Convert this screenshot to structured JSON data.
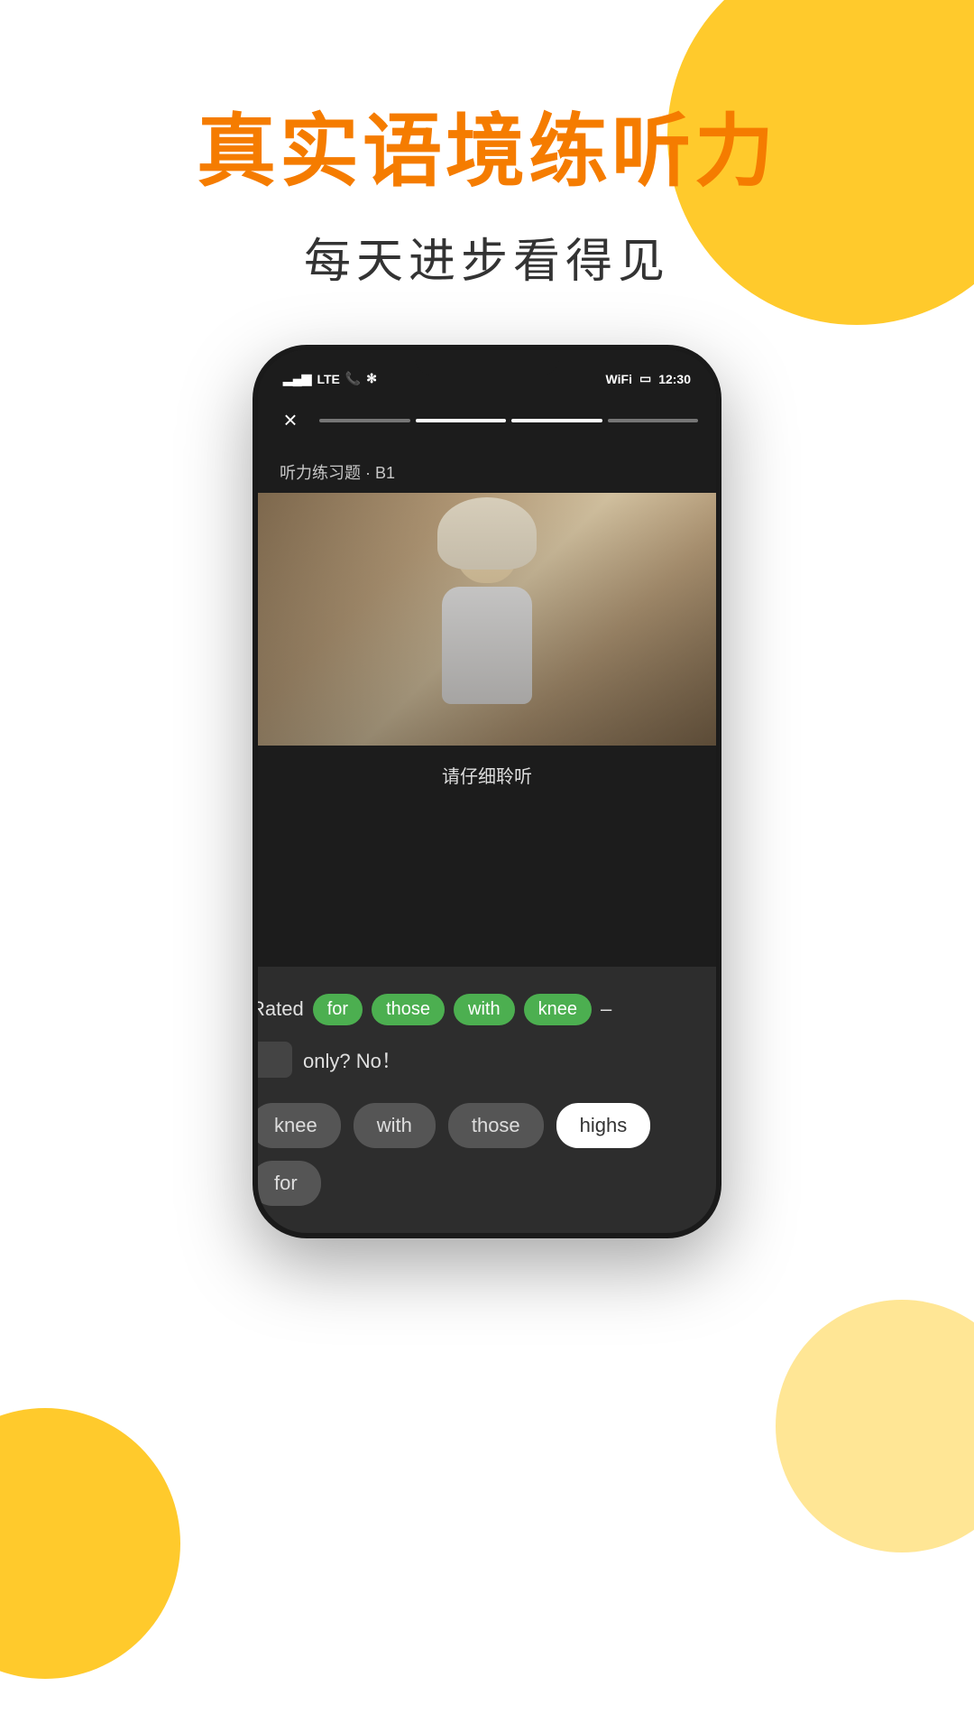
{
  "page": {
    "main_title": "真实语境练听力",
    "sub_title": "每天进步看得见",
    "bg_color": "#ffffff",
    "accent_color": "#F57C00",
    "circle_color": "#FFC107"
  },
  "phone": {
    "status_bar": {
      "signal": "▂▄▆",
      "network": "LTE",
      "time": "12:30",
      "wifi": "WiFi",
      "battery": "□"
    },
    "top_bar": {
      "close_label": "×",
      "progress_segments": [
        {
          "state": "done"
        },
        {
          "state": "active"
        },
        {
          "state": "active"
        },
        {
          "state": "done"
        }
      ]
    },
    "exercise_label": "听力练习题 · B1",
    "listen_prompt": "请仔细聆听",
    "answer_card": {
      "sentence_part1": "Rated",
      "pill1": "for",
      "pill2": "those",
      "pill3": "with",
      "pill4": "knee",
      "dash": "–",
      "blank_placeholder": "",
      "suffix_text": "only?  No！",
      "choices": [
        {
          "label": "knee",
          "selected": false
        },
        {
          "label": "with",
          "selected": false
        },
        {
          "label": "those",
          "selected": false
        },
        {
          "label": "highs",
          "selected": true
        },
        {
          "label": "for",
          "selected": false
        }
      ]
    }
  }
}
